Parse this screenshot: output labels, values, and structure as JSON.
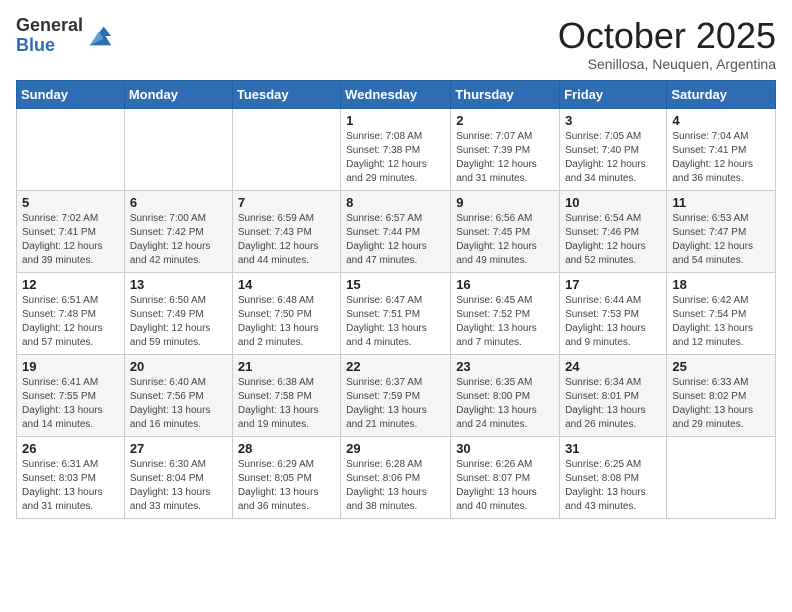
{
  "logo": {
    "general": "General",
    "blue": "Blue"
  },
  "header": {
    "month": "October 2025",
    "location": "Senillosa, Neuquen, Argentina"
  },
  "weekdays": [
    "Sunday",
    "Monday",
    "Tuesday",
    "Wednesday",
    "Thursday",
    "Friday",
    "Saturday"
  ],
  "weeks": [
    [
      {
        "day": "",
        "info": ""
      },
      {
        "day": "",
        "info": ""
      },
      {
        "day": "",
        "info": ""
      },
      {
        "day": "1",
        "info": "Sunrise: 7:08 AM\nSunset: 7:38 PM\nDaylight: 12 hours\nand 29 minutes."
      },
      {
        "day": "2",
        "info": "Sunrise: 7:07 AM\nSunset: 7:39 PM\nDaylight: 12 hours\nand 31 minutes."
      },
      {
        "day": "3",
        "info": "Sunrise: 7:05 AM\nSunset: 7:40 PM\nDaylight: 12 hours\nand 34 minutes."
      },
      {
        "day": "4",
        "info": "Sunrise: 7:04 AM\nSunset: 7:41 PM\nDaylight: 12 hours\nand 36 minutes."
      }
    ],
    [
      {
        "day": "5",
        "info": "Sunrise: 7:02 AM\nSunset: 7:41 PM\nDaylight: 12 hours\nand 39 minutes."
      },
      {
        "day": "6",
        "info": "Sunrise: 7:00 AM\nSunset: 7:42 PM\nDaylight: 12 hours\nand 42 minutes."
      },
      {
        "day": "7",
        "info": "Sunrise: 6:59 AM\nSunset: 7:43 PM\nDaylight: 12 hours\nand 44 minutes."
      },
      {
        "day": "8",
        "info": "Sunrise: 6:57 AM\nSunset: 7:44 PM\nDaylight: 12 hours\nand 47 minutes."
      },
      {
        "day": "9",
        "info": "Sunrise: 6:56 AM\nSunset: 7:45 PM\nDaylight: 12 hours\nand 49 minutes."
      },
      {
        "day": "10",
        "info": "Sunrise: 6:54 AM\nSunset: 7:46 PM\nDaylight: 12 hours\nand 52 minutes."
      },
      {
        "day": "11",
        "info": "Sunrise: 6:53 AM\nSunset: 7:47 PM\nDaylight: 12 hours\nand 54 minutes."
      }
    ],
    [
      {
        "day": "12",
        "info": "Sunrise: 6:51 AM\nSunset: 7:48 PM\nDaylight: 12 hours\nand 57 minutes."
      },
      {
        "day": "13",
        "info": "Sunrise: 6:50 AM\nSunset: 7:49 PM\nDaylight: 12 hours\nand 59 minutes."
      },
      {
        "day": "14",
        "info": "Sunrise: 6:48 AM\nSunset: 7:50 PM\nDaylight: 13 hours\nand 2 minutes."
      },
      {
        "day": "15",
        "info": "Sunrise: 6:47 AM\nSunset: 7:51 PM\nDaylight: 13 hours\nand 4 minutes."
      },
      {
        "day": "16",
        "info": "Sunrise: 6:45 AM\nSunset: 7:52 PM\nDaylight: 13 hours\nand 7 minutes."
      },
      {
        "day": "17",
        "info": "Sunrise: 6:44 AM\nSunset: 7:53 PM\nDaylight: 13 hours\nand 9 minutes."
      },
      {
        "day": "18",
        "info": "Sunrise: 6:42 AM\nSunset: 7:54 PM\nDaylight: 13 hours\nand 12 minutes."
      }
    ],
    [
      {
        "day": "19",
        "info": "Sunrise: 6:41 AM\nSunset: 7:55 PM\nDaylight: 13 hours\nand 14 minutes."
      },
      {
        "day": "20",
        "info": "Sunrise: 6:40 AM\nSunset: 7:56 PM\nDaylight: 13 hours\nand 16 minutes."
      },
      {
        "day": "21",
        "info": "Sunrise: 6:38 AM\nSunset: 7:58 PM\nDaylight: 13 hours\nand 19 minutes."
      },
      {
        "day": "22",
        "info": "Sunrise: 6:37 AM\nSunset: 7:59 PM\nDaylight: 13 hours\nand 21 minutes."
      },
      {
        "day": "23",
        "info": "Sunrise: 6:35 AM\nSunset: 8:00 PM\nDaylight: 13 hours\nand 24 minutes."
      },
      {
        "day": "24",
        "info": "Sunrise: 6:34 AM\nSunset: 8:01 PM\nDaylight: 13 hours\nand 26 minutes."
      },
      {
        "day": "25",
        "info": "Sunrise: 6:33 AM\nSunset: 8:02 PM\nDaylight: 13 hours\nand 29 minutes."
      }
    ],
    [
      {
        "day": "26",
        "info": "Sunrise: 6:31 AM\nSunset: 8:03 PM\nDaylight: 13 hours\nand 31 minutes."
      },
      {
        "day": "27",
        "info": "Sunrise: 6:30 AM\nSunset: 8:04 PM\nDaylight: 13 hours\nand 33 minutes."
      },
      {
        "day": "28",
        "info": "Sunrise: 6:29 AM\nSunset: 8:05 PM\nDaylight: 13 hours\nand 36 minutes."
      },
      {
        "day": "29",
        "info": "Sunrise: 6:28 AM\nSunset: 8:06 PM\nDaylight: 13 hours\nand 38 minutes."
      },
      {
        "day": "30",
        "info": "Sunrise: 6:26 AM\nSunset: 8:07 PM\nDaylight: 13 hours\nand 40 minutes."
      },
      {
        "day": "31",
        "info": "Sunrise: 6:25 AM\nSunset: 8:08 PM\nDaylight: 13 hours\nand 43 minutes."
      },
      {
        "day": "",
        "info": ""
      }
    ]
  ]
}
